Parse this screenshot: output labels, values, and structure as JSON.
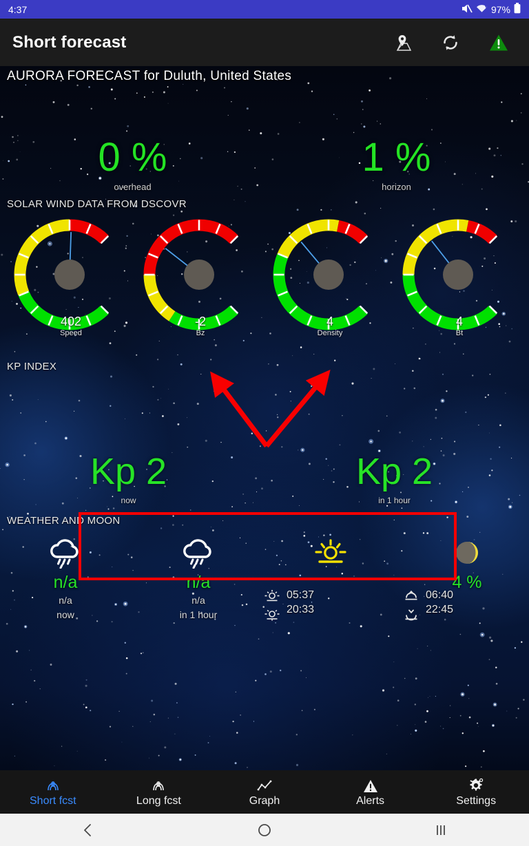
{
  "status_bar": {
    "time": "4:37",
    "battery_percent": "97%",
    "icons": [
      "mute-icon",
      "wifi-icon",
      "battery-icon"
    ]
  },
  "app_bar": {
    "title": "Short forecast",
    "actions": [
      {
        "name": "map-location-icon",
        "label": "Location map"
      },
      {
        "name": "refresh-icon",
        "label": "Refresh"
      },
      {
        "name": "alert-warning-icon",
        "label": "Alerts"
      }
    ]
  },
  "header": {
    "forecast_title": "AURORA FORECAST for Duluth, United States"
  },
  "probability": {
    "overhead": {
      "value": "0 %",
      "caption": "overhead"
    },
    "horizon": {
      "value": "1 %",
      "caption": "horizon"
    }
  },
  "solar_wind": {
    "section_label": "SOLAR WIND DATA FROM DSCOVR",
    "gauges": [
      {
        "value": "402",
        "label": "Speed",
        "needle_deg": 2,
        "bands": [
          {
            "color": "#00e000",
            "from": 0,
            "to": 113
          },
          {
            "color": "#f0e400",
            "from": 113,
            "to": 225
          },
          {
            "color": "#f00000",
            "from": 225,
            "to": 270
          }
        ]
      },
      {
        "value": "-2",
        "label": "Bz",
        "needle_deg": -52,
        "bands": [
          {
            "color": "#00e000",
            "from": 0,
            "to": 78
          },
          {
            "color": "#f0e400",
            "from": 78,
            "to": 135
          },
          {
            "color": "#f00000",
            "from": 135,
            "to": 270
          }
        ]
      },
      {
        "value": "4",
        "label": "Density",
        "needle_deg": -40,
        "bands": [
          {
            "color": "#00e000",
            "from": 0,
            "to": 157
          },
          {
            "color": "#f0e400",
            "from": 157,
            "to": 236
          },
          {
            "color": "#f00000",
            "from": 236,
            "to": 270
          }
        ]
      },
      {
        "value": "4",
        "label": "Bt",
        "needle_deg": -38,
        "bands": [
          {
            "color": "#00e000",
            "from": 0,
            "to": 135
          },
          {
            "color": "#f0e400",
            "from": 135,
            "to": 236
          },
          {
            "color": "#f00000",
            "from": 236,
            "to": 270
          }
        ]
      }
    ]
  },
  "kp_index": {
    "section_label": "KP INDEX",
    "now": {
      "value": "Kp 2",
      "caption": "now"
    },
    "in_one_hour": {
      "value": "Kp 2",
      "caption": "in 1 hour"
    }
  },
  "annotation": {
    "box_color": "#f80000",
    "arrow_color": "#f80000"
  },
  "weather_moon": {
    "section_label": "WEATHER AND MOON",
    "now": {
      "icon": "rain-cloud-icon",
      "main": "n/a",
      "sub": "n/a",
      "when": "now"
    },
    "in_one_hour": {
      "icon": "rain-cloud-icon",
      "main": "n/a",
      "sub": "n/a",
      "when": "in 1 hour"
    },
    "sun": {
      "icon": "sun-icon",
      "rise": "05:37",
      "set": "20:33",
      "rise_icon": "sunrise-icon",
      "set_icon": "sunset-icon"
    },
    "moon": {
      "icon": "moon-crescent-icon",
      "illumination": "4 %",
      "rise": "06:40",
      "set": "22:45",
      "rise_icon": "moonrise-icon",
      "set_icon": "moonset-icon"
    }
  },
  "bottom_nav": {
    "active_index": 0,
    "items": [
      {
        "label": "Short fcst",
        "icon": "aurora-icon"
      },
      {
        "label": "Long fcst",
        "icon": "aurora-icon"
      },
      {
        "label": "Graph",
        "icon": "chart-line-icon"
      },
      {
        "label": "Alerts",
        "icon": "warning-triangle-icon"
      },
      {
        "label": "Settings",
        "icon": "gear-icon"
      }
    ]
  },
  "system_nav": {
    "items": [
      {
        "name": "back-icon",
        "glyph": "‹"
      },
      {
        "name": "home-icon",
        "glyph": "◯"
      },
      {
        "name": "recents-icon",
        "glyph": "|||"
      }
    ]
  },
  "colors": {
    "accent_green": "#24e324",
    "status_bar": "#3b3bc4",
    "app_bar": "#1c1c1c",
    "nav_active": "#3a8bfd",
    "annotation_red": "#f80000"
  }
}
